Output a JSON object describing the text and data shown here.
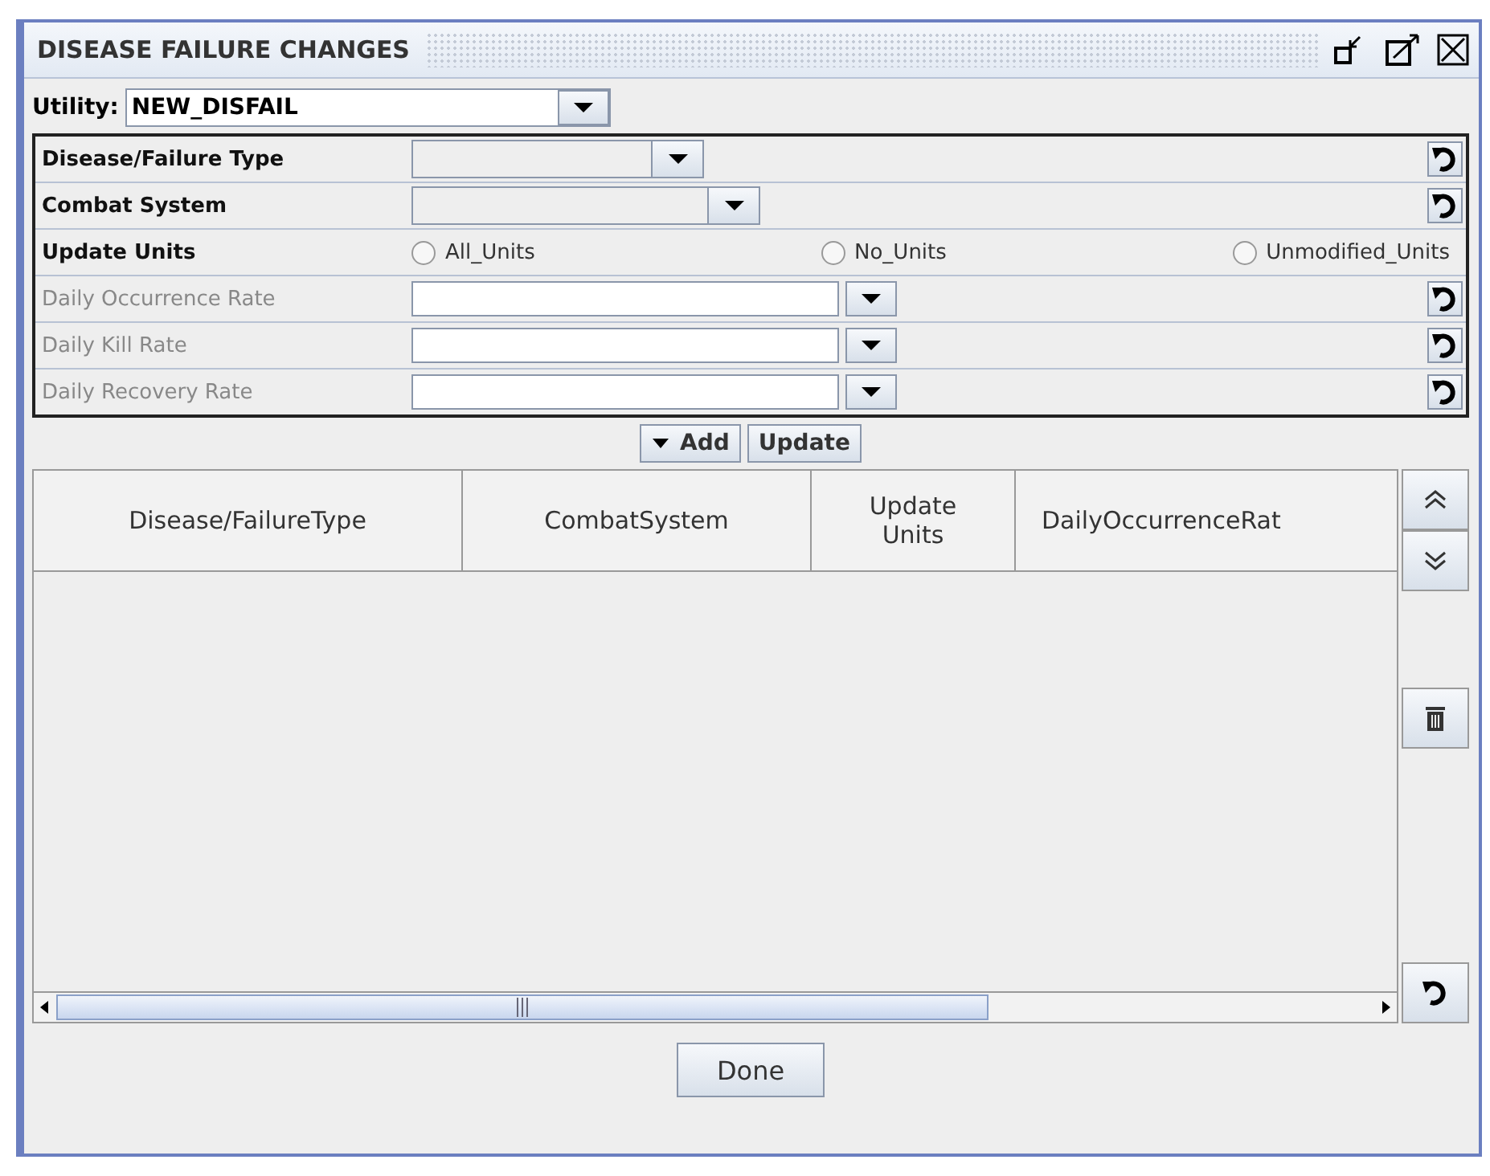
{
  "window": {
    "title": "DISEASE FAILURE CHANGES"
  },
  "utility": {
    "label": "Utility:",
    "value": "NEW_DISFAIL"
  },
  "form_rows": [
    {
      "kind": "combo",
      "label": "Disease/Failure Type",
      "disabled": false
    },
    {
      "kind": "combo",
      "label": "Combat System",
      "disabled": false
    },
    {
      "kind": "radio",
      "label": "Update Units",
      "options": [
        {
          "label": "All_Units",
          "selected": false
        },
        {
          "label": "No_Units",
          "selected": false
        },
        {
          "label": "Unmodified_Units",
          "selected": false
        }
      ]
    },
    {
      "kind": "field",
      "label": "Daily Occurrence Rate",
      "disabled": true
    },
    {
      "kind": "field",
      "label": "Daily Kill Rate",
      "disabled": true
    },
    {
      "kind": "field",
      "label": "Daily Recovery Rate",
      "disabled": true
    }
  ],
  "actions": [
    "Add",
    "Update"
  ],
  "table": {
    "columns": [
      "Disease/FailureType",
      "CombatSystem",
      "Update Units",
      "DailyOccurrenceRat"
    ]
  },
  "footer_button": "Done"
}
